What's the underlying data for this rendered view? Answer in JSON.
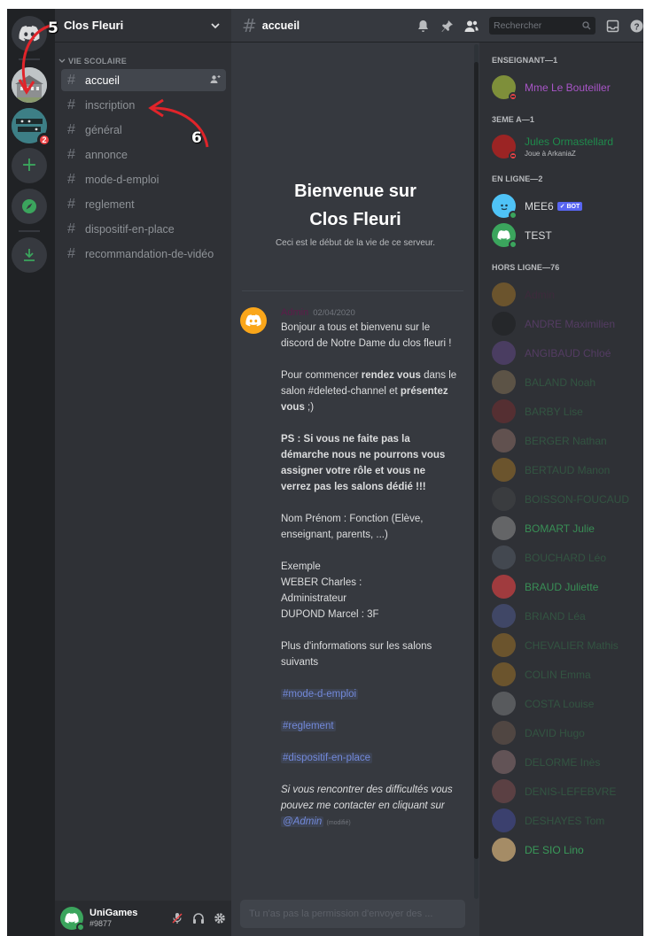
{
  "server": {
    "name": "Clos Fleuri",
    "category": "VIE SCOLAIRE",
    "channels": [
      {
        "name": "accueil",
        "active": true
      },
      {
        "name": "inscription",
        "active": false
      },
      {
        "name": "général",
        "active": false
      },
      {
        "name": "annonce",
        "active": false
      },
      {
        "name": "mode-d-emploi",
        "active": false
      },
      {
        "name": "reglement",
        "active": false
      },
      {
        "name": "dispositif-en-place",
        "active": false
      },
      {
        "name": "recommandation-de-vidéo",
        "active": false
      }
    ],
    "rail": {
      "badge_count": "2"
    }
  },
  "user_panel": {
    "username": "UniGames",
    "tag": "#9877"
  },
  "topbar": {
    "channel": "accueil",
    "search_placeholder": "Rechercher"
  },
  "welcome": {
    "title_line1": "Bienvenue sur",
    "title_line2": "Clos Fleuri",
    "subtitle": "Ceci est le début de la vie de ce serveur."
  },
  "message": {
    "author": "Admin",
    "date": "02/04/2020",
    "lines": {
      "p1": "Bonjour a tous et bienvenu sur le discord de Notre Dame du clos fleuri !",
      "p2_a": "Pour commencer ",
      "p2_b": "rendez vous",
      "p2_c": " dans le salon #deleted-channel et ",
      "p2_d": "présentez vous",
      "p2_e": " ;)",
      "p3": "PS : Si vous ne faite pas la démarche nous ne pourrons vous assigner votre rôle et vous ne verrez pas les salons dédié !!!",
      "p4": "Nom Prénom : Fonction (Elève, enseignant, parents, ...)",
      "p5_1": "Exemple",
      "p5_2": "WEBER Charles :",
      "p5_3": "Administrateur",
      "p5_4": "DUPOND Marcel : 3F",
      "p6": "Plus d'informations sur les salons suivants",
      "link1": "#mode-d-emploi",
      "link2": "#reglement",
      "link3": "#dispositif-en-place",
      "p7": "Si vous rencontrer des difficultés vous pouvez me contacter en cliquant sur",
      "mention": "@Admin",
      "edited": "(modifié)"
    }
  },
  "composer": {
    "placeholder": "Tu n'as pas la permission d'envoyer des ..."
  },
  "members": {
    "groups": {
      "teacher": "ENSEIGNANT—1",
      "class": "3EME A—1",
      "online": "EN LIGNE—2",
      "offline": "HORS LIGNE—76"
    },
    "teacher": {
      "name": "Mme Le Bouteiller",
      "color": "#a855c7"
    },
    "student": {
      "name": "Jules Ormastellard",
      "color": "#1f8b4c",
      "activity": "Joue à ArkaniaZ"
    },
    "online": [
      {
        "name": "MEE6",
        "bot": "✓ BOT"
      },
      {
        "name": "TEST"
      }
    ],
    "offline": [
      {
        "name": "Admin",
        "color": "#5e1b4a"
      },
      {
        "name": "ANDRE Maximilien",
        "color": "#a855c7"
      },
      {
        "name": "ANGIBAUD Chloé",
        "color": "#a855c7"
      },
      {
        "name": "BALAND Noah",
        "color": "#3ba55d"
      },
      {
        "name": "BARBY Lise",
        "color": "#3ba55d"
      },
      {
        "name": "BERGER Nathan",
        "color": "#3ba55d"
      },
      {
        "name": "BERTAUD Manon",
        "color": "#3ba55d"
      },
      {
        "name": "BOISSON-FOUCAUD",
        "color": "#3ba55d"
      },
      {
        "name": "BOMART Julie",
        "color": "#3ba55d"
      },
      {
        "name": "BOUCHARD Léo",
        "color": "#3ba55d"
      },
      {
        "name": "BRAUD Juliette",
        "color": "#3ba55d"
      },
      {
        "name": "BRIAND Léa",
        "color": "#3ba55d"
      },
      {
        "name": "CHEVALIER Mathis",
        "color": "#3ba55d"
      },
      {
        "name": "COLIN Emma",
        "color": "#3ba55d"
      },
      {
        "name": "COSTA Louise",
        "color": "#3ba55d"
      },
      {
        "name": "DAVID Hugo",
        "color": "#3ba55d"
      },
      {
        "name": "DELORME Inès",
        "color": "#3ba55d"
      },
      {
        "name": "DENIS-LEFEBVRE",
        "color": "#3ba55d"
      },
      {
        "name": "DESHAYES Tom",
        "color": "#3ba55d"
      },
      {
        "name": "DE SIO Lino",
        "color": "#3ba55d"
      }
    ]
  },
  "annotations": {
    "n5": "5",
    "n6": "6"
  },
  "colors": {
    "accent": "#5865f2",
    "rail_bg": "#202225",
    "channels_bg": "#2f3136",
    "main_bg": "#36393f",
    "arrow": "#e0242a"
  }
}
